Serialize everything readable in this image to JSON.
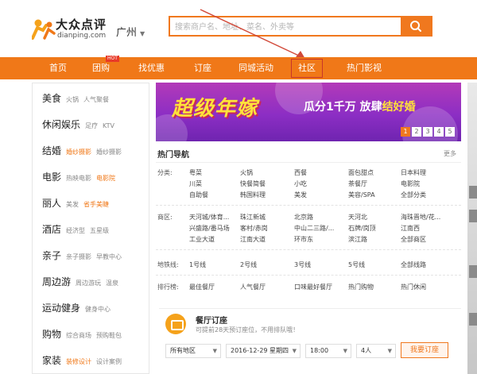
{
  "header": {
    "logo_cn": "大众点评",
    "logo_en": "dianping.com",
    "city": "广州",
    "search_placeholder": "搜索商户名、地址、菜名、外卖等"
  },
  "colors": {
    "accent": "#f07818",
    "highlight": "#c8362a",
    "banner": "#8c2ec4"
  },
  "nav": {
    "items": [
      "首页",
      "团购",
      "找优惠",
      "订座",
      "同城活动",
      "社区",
      "热门影视"
    ],
    "hot_badge": "HOT",
    "active": "社区"
  },
  "sidebar": [
    {
      "name": "美食",
      "subs": [
        "火锅",
        "人气聚餐"
      ]
    },
    {
      "name": "休闲娱乐",
      "subs": [
        "足疗",
        "KTV"
      ]
    },
    {
      "name": "结婚",
      "subs": [
        "婚纱摄影",
        "婚纱摄影"
      ]
    },
    {
      "name": "电影",
      "subs": [
        "热映电影",
        "电影院"
      ]
    },
    {
      "name": "丽人",
      "subs": [
        "美发",
        "省手美睫"
      ]
    },
    {
      "name": "酒店",
      "subs": [
        "经济型",
        "五星级"
      ]
    },
    {
      "name": "亲子",
      "subs": [
        "亲子摄影",
        "早教中心"
      ]
    },
    {
      "name": "周边游",
      "subs": [
        "周边游玩",
        "温泉"
      ]
    },
    {
      "name": "运动健身",
      "subs": [
        "健身中心"
      ]
    },
    {
      "name": "购物",
      "subs": [
        "综合商场",
        "预购鞋包"
      ]
    },
    {
      "name": "家装",
      "subs": [
        "装修设计",
        "设计案例"
      ]
    }
  ],
  "banner": {
    "headline": "超级年嫁",
    "slogan_a": "瓜分1千万 放肆",
    "slogan_b": "结好婚",
    "pages": [
      "1",
      "2",
      "3",
      "4",
      "5"
    ],
    "active_page": "1"
  },
  "hotnav": {
    "title": "热门导航",
    "more": "更多",
    "rows": [
      {
        "label": "分类:",
        "cells": [
          "粤菜",
          "火锅",
          "西餐",
          "面包甜点",
          "日本料理",
          "川菜",
          "快餐简餐",
          "小吃",
          "茶餐厅",
          "电影院",
          "自助餐",
          "韩国料理",
          "美发",
          "美容/SPA",
          "全部分类"
        ]
      },
      {
        "label": "商区:",
        "cells": [
          "天河城/体育...",
          "珠江新城",
          "北京路",
          "天河北",
          "海珠晋地/花...",
          "兴盛路/番马场",
          "客村/赤岗",
          "中山二三路/...",
          "石牌/岗顶",
          "江南西",
          "工业大道",
          "江南大道",
          "环市东",
          "滨江路",
          "全部商区"
        ]
      },
      {
        "label": "地铁线:",
        "cells": [
          "1号线",
          "2号线",
          "3号线",
          "5号线",
          "全部线路"
        ]
      },
      {
        "label": "排行榜:",
        "cells": [
          "最佳餐厅",
          "人气餐厅",
          "口味最好餐厅",
          "热门购物",
          "热门休闲"
        ]
      }
    ]
  },
  "booking": {
    "title": "餐厅订座",
    "desc": "可提前28天预订座位，不用排队哦！",
    "area": "所有地区",
    "date": "2016-12-29 星期四",
    "time": "18:00",
    "people": "4人",
    "submit": "我要订座"
  }
}
